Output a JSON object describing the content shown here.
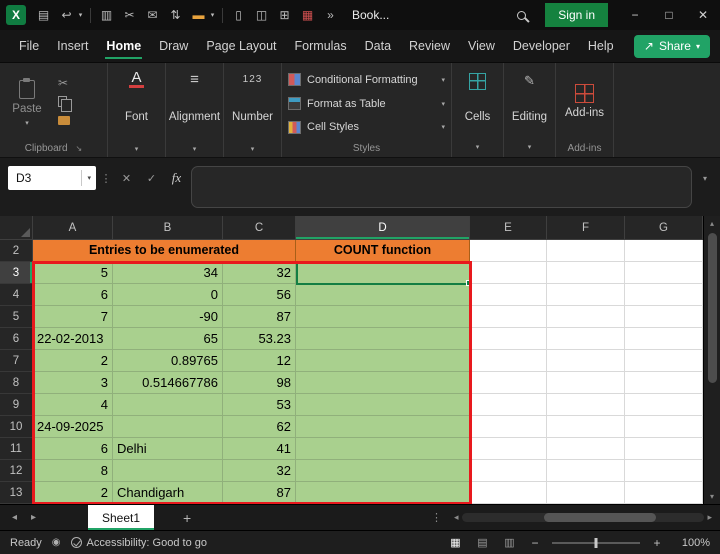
{
  "colors": {
    "accent-green": "#21a366",
    "header-orange": "#ed7d31",
    "cell-green": "#a9d08e",
    "range-red": "#e8191d",
    "select-green": "#137e43"
  },
  "titlebar": {
    "title": "Book...",
    "sign_in_label": "Sign in"
  },
  "menubar": {
    "items": [
      "File",
      "Insert",
      "Home",
      "Draw",
      "Page Layout",
      "Formulas",
      "Data",
      "Review",
      "View",
      "Developer",
      "Help"
    ],
    "active_item": "Home",
    "share_label": "Share"
  },
  "ribbon": {
    "paste_label": "Paste",
    "font_label": "Font",
    "alignment_label": "Alignment",
    "number_label": "Number",
    "styles_buttons": [
      "Conditional Formatting",
      "Format as Table",
      "Cell Styles"
    ],
    "cells_label": "Cells",
    "editing_label": "Editing",
    "addins_label": "Add-ins",
    "group_labels": {
      "clipboard": "Clipboard",
      "styles": "Styles",
      "addins": "Add-ins"
    }
  },
  "formula_bar": {
    "name_box": "D3",
    "fx_label": "fx"
  },
  "grid": {
    "columns": [
      "A",
      "B",
      "C",
      "D",
      "E",
      "F",
      "G"
    ],
    "selected_column": "D",
    "selected_row": "3",
    "header_row": {
      "row_number": "2",
      "entries_label": "Entries to be enumerated",
      "count_label": "COUNT function"
    },
    "data_rows": [
      {
        "n": "3",
        "a": "5",
        "b": "34",
        "c": "32",
        "d": ""
      },
      {
        "n": "4",
        "a": "6",
        "b": "0",
        "c": "56",
        "d": ""
      },
      {
        "n": "5",
        "a": "7",
        "b": "-90",
        "c": "87",
        "d": ""
      },
      {
        "n": "6",
        "a": "22-02-2013",
        "b": "65",
        "c": "53.23",
        "d": ""
      },
      {
        "n": "7",
        "a": "2",
        "b": "0.89765",
        "c": "12",
        "d": ""
      },
      {
        "n": "8",
        "a": "3",
        "b": "0.514667786",
        "c": "98",
        "d": ""
      },
      {
        "n": "9",
        "a": "4",
        "b": "",
        "c": "53",
        "d": ""
      },
      {
        "n": "10",
        "a": "24-09-2025",
        "b": "",
        "c": "62",
        "d": ""
      },
      {
        "n": "11",
        "a": "6",
        "b": "Delhi",
        "c": "41",
        "d": ""
      },
      {
        "n": "12",
        "a": "8",
        "b": "",
        "c": "32",
        "d": ""
      },
      {
        "n": "13",
        "a": "2",
        "b": "Chandigarh",
        "c": "87",
        "d": ""
      }
    ]
  },
  "sheet_bar": {
    "active_tab": "Sheet1"
  },
  "status_bar": {
    "ready_label": "Ready",
    "accessibility_label": "Accessibility: Good to go",
    "zoom_level": "100%"
  },
  "icons": {
    "excel_logo": "X",
    "save": "▤",
    "undo": "↩",
    "chevron_down": "▾",
    "workbook": "▥",
    "cut": "✂",
    "mail": "✉",
    "sort": "⇅",
    "highlight": "▬",
    "new_doc": "▯",
    "pin": "◫",
    "table": "⊞",
    "grid_red": "▦",
    "more": "»",
    "minimize": "−",
    "maximize": "□",
    "close": "✕",
    "cancel": "✕",
    "check": "✓",
    "dots_v": "⋮",
    "prev": "◂",
    "next": "▸",
    "plus": "+",
    "up": "▴",
    "down": "▾",
    "dialog_launcher": "↘",
    "share_arrow": "↗",
    "font_a": "A",
    "align_lines": "≡",
    "number_123": "123",
    "pencil": "✎",
    "record": "◉",
    "view_normal": "▦",
    "view_layout": "▤",
    "view_break": "▥",
    "zoom_minus": "−",
    "zoom_plus": "+"
  }
}
